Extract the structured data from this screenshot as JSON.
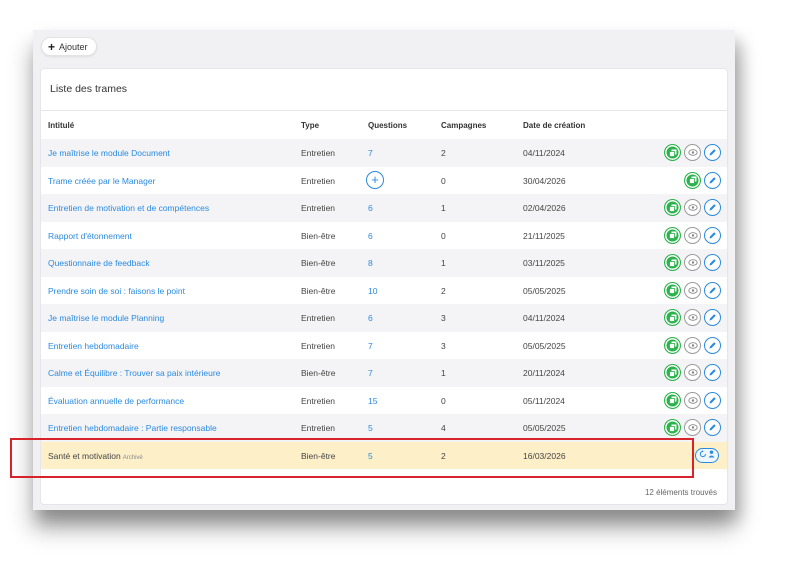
{
  "toolbar": {
    "add_label": "Ajouter"
  },
  "card": {
    "title": "Liste des trames"
  },
  "columns": [
    "Intitulé",
    "Type",
    "Questions",
    "Campagnes",
    "Date de création"
  ],
  "rows": [
    {
      "title": "Je maîtrise le module Document",
      "type": "Entretien",
      "questions": "7",
      "campaigns": "2",
      "date": "04/11/2024"
    },
    {
      "title": "Trame créée par le Manager",
      "type": "Entretien",
      "questions": "+",
      "campaigns": "0",
      "date": "30/04/2026"
    },
    {
      "title": "Entretien de motivation et de compétences",
      "type": "Entretien",
      "questions": "6",
      "campaigns": "1",
      "date": "02/04/2026"
    },
    {
      "title": "Rapport d'étonnement",
      "type": "Bien-être",
      "questions": "6",
      "campaigns": "0",
      "date": "21/11/2025"
    },
    {
      "title": "Questionnaire de feedback",
      "type": "Bien-être",
      "questions": "8",
      "campaigns": "1",
      "date": "03/11/2025"
    },
    {
      "title": "Prendre soin de soi : faisons le point",
      "type": "Bien-être",
      "questions": "10",
      "campaigns": "2",
      "date": "05/05/2025"
    },
    {
      "title": "Je maîtrise le module Planning",
      "type": "Entretien",
      "questions": "6",
      "campaigns": "3",
      "date": "04/11/2024"
    },
    {
      "title": "Entretien hebdomadaire",
      "type": "Entretien",
      "questions": "7",
      "campaigns": "3",
      "date": "05/05/2025"
    },
    {
      "title": "Calme et Équilibre : Trouver sa paix intérieure",
      "type": "Bien-être",
      "questions": "7",
      "campaigns": "1",
      "date": "20/11/2024"
    },
    {
      "title": "Évaluation annuelle de performance",
      "type": "Entretien",
      "questions": "15",
      "campaigns": "0",
      "date": "05/11/2024"
    },
    {
      "title": "Entretien hebdomadaire : Partie responsable",
      "type": "Entretien",
      "questions": "5",
      "campaigns": "4",
      "date": "05/05/2025"
    },
    {
      "title": "Santé et motivation",
      "badge": "Archivé",
      "type": "Bien-être",
      "questions": "5",
      "campaigns": "2",
      "date": "16/03/2026"
    }
  ],
  "footer": {
    "count_label": "12 éléments trouvés"
  },
  "colors": {
    "accent": "#2a8ae0",
    "duplicate": "#2bb24c",
    "archived_bg": "#fdf0c8",
    "highlight": "#d9232a"
  },
  "icons": {
    "duplicate": "copy-icon",
    "preview": "eye-icon",
    "edit": "pencil-icon",
    "restore": "restore-icon"
  }
}
